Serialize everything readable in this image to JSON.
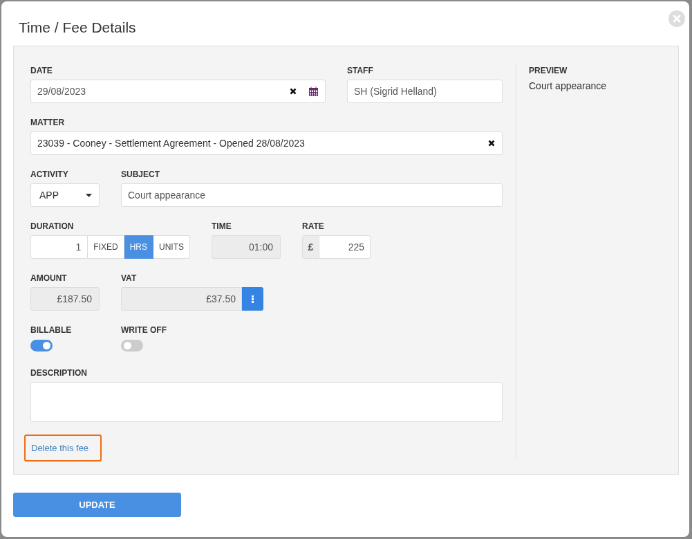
{
  "dialog": {
    "title": "Time / Fee Details"
  },
  "date": {
    "label": "DATE",
    "value": "29/08/2023"
  },
  "staff": {
    "label": "STAFF",
    "value": "SH (Sigrid Helland)"
  },
  "matter": {
    "label": "MATTER",
    "value": "23039 - Cooney - Settlement Agreement - Opened 28/08/2023"
  },
  "activity": {
    "label": "ACTIVITY",
    "value": "APP"
  },
  "subject": {
    "label": "SUBJECT",
    "value": "Court appearance"
  },
  "duration": {
    "label": "DURATION",
    "value": "1",
    "units": [
      {
        "label": "FIXED",
        "selected": false
      },
      {
        "label": "HRS",
        "selected": true
      },
      {
        "label": "UNITS",
        "selected": false
      }
    ]
  },
  "time": {
    "label": "TIME",
    "value": "01:00"
  },
  "rate": {
    "label": "RATE",
    "currency": "£",
    "value": "225"
  },
  "amount": {
    "label": "AMOUNT",
    "value": "£187.50"
  },
  "vat": {
    "label": "VAT",
    "value": "£37.50"
  },
  "toggles": [
    {
      "label": "BILLABLE",
      "on": true
    },
    {
      "label": "WRITE OFF",
      "on": false
    }
  ],
  "description": {
    "label": "DESCRIPTION"
  },
  "delete_link": {
    "label": "Delete this fee",
    "highlighted": true
  },
  "preview": {
    "label": "PREVIEW",
    "text": "Court appearance"
  },
  "update_button": "UPDATE"
}
